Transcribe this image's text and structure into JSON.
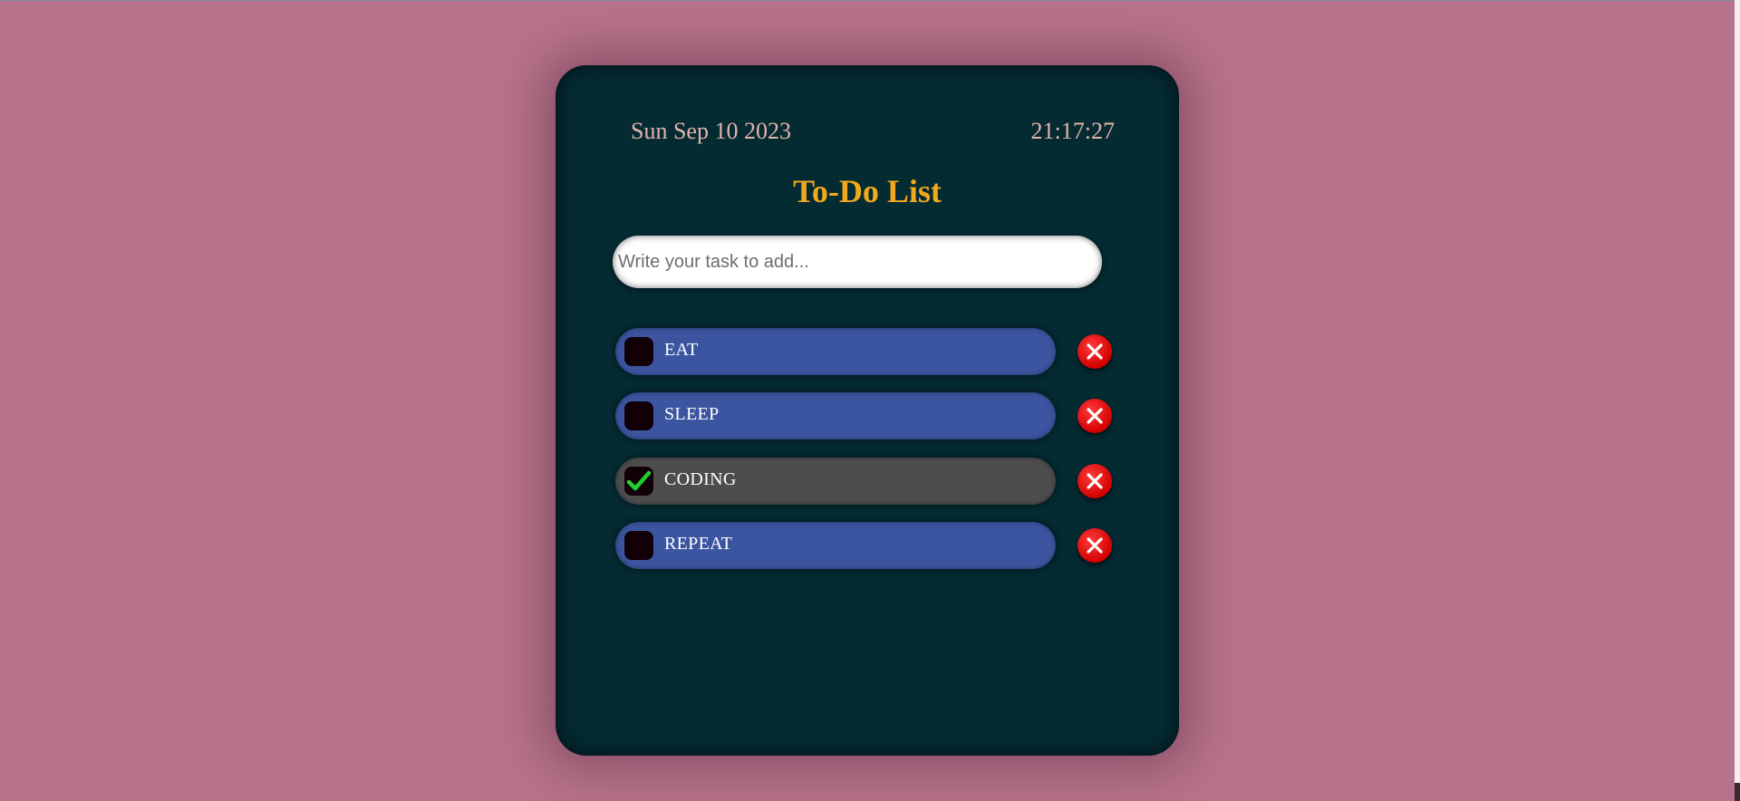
{
  "header": {
    "date": "Sun Sep 10 2023",
    "time": "21:17:27",
    "title": "To-Do List"
  },
  "input": {
    "placeholder": "Write your task to add...",
    "value": ""
  },
  "tasks": [
    {
      "label": "EAT",
      "done": false
    },
    {
      "label": "SLEEP",
      "done": false
    },
    {
      "label": "CODING",
      "done": true
    },
    {
      "label": "REPEAT",
      "done": false
    }
  ],
  "icons": {
    "checkmark": "checkmark-icon",
    "delete": "close-icon"
  },
  "colors": {
    "page_bg": "#b7738b",
    "card_bg": "#042a32",
    "title": "#f0a91c",
    "date_time": "#e3b3aa",
    "task_pill": "#3b55a0",
    "task_done_pill": "#4d4d4d",
    "delete_button": "#e00000",
    "checkmark": "#1fd12a"
  }
}
